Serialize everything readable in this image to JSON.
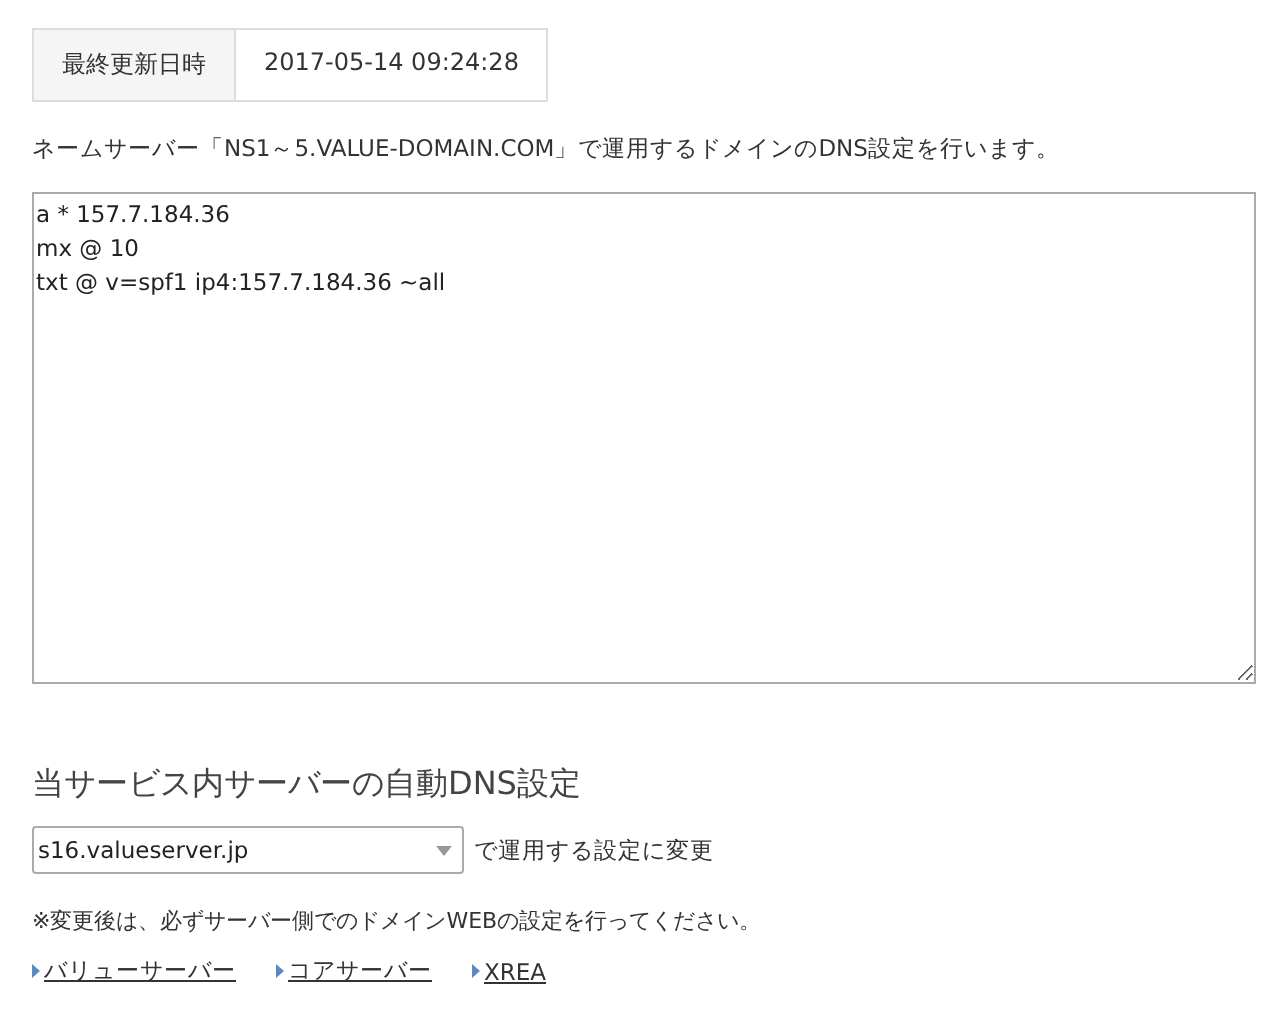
{
  "info_table": {
    "label": "最終更新日時",
    "value": "2017-05-14 09:24:28"
  },
  "description": "ネームサーバー「NS1～5.VALUE-DOMAIN.COM」で運用するドメインのDNS設定を行います。",
  "dns_records": {
    "value": "a * 157.7.184.36\nmx @ 10\ntxt @ v=spf1 ip4:157.7.184.36 ~all"
  },
  "auto_dns": {
    "heading": "当サービス内サーバーの自動DNS設定",
    "server_select": {
      "value": "s16.valueserver.jp"
    },
    "select_suffix": "で運用する設定に変更",
    "note": "※変更後は、必ずサーバー側でのドメインWEBの設定を行ってください。",
    "links": [
      {
        "label": "バリューサーバー"
      },
      {
        "label": "コアサーバー"
      },
      {
        "label": "XREA"
      }
    ]
  }
}
